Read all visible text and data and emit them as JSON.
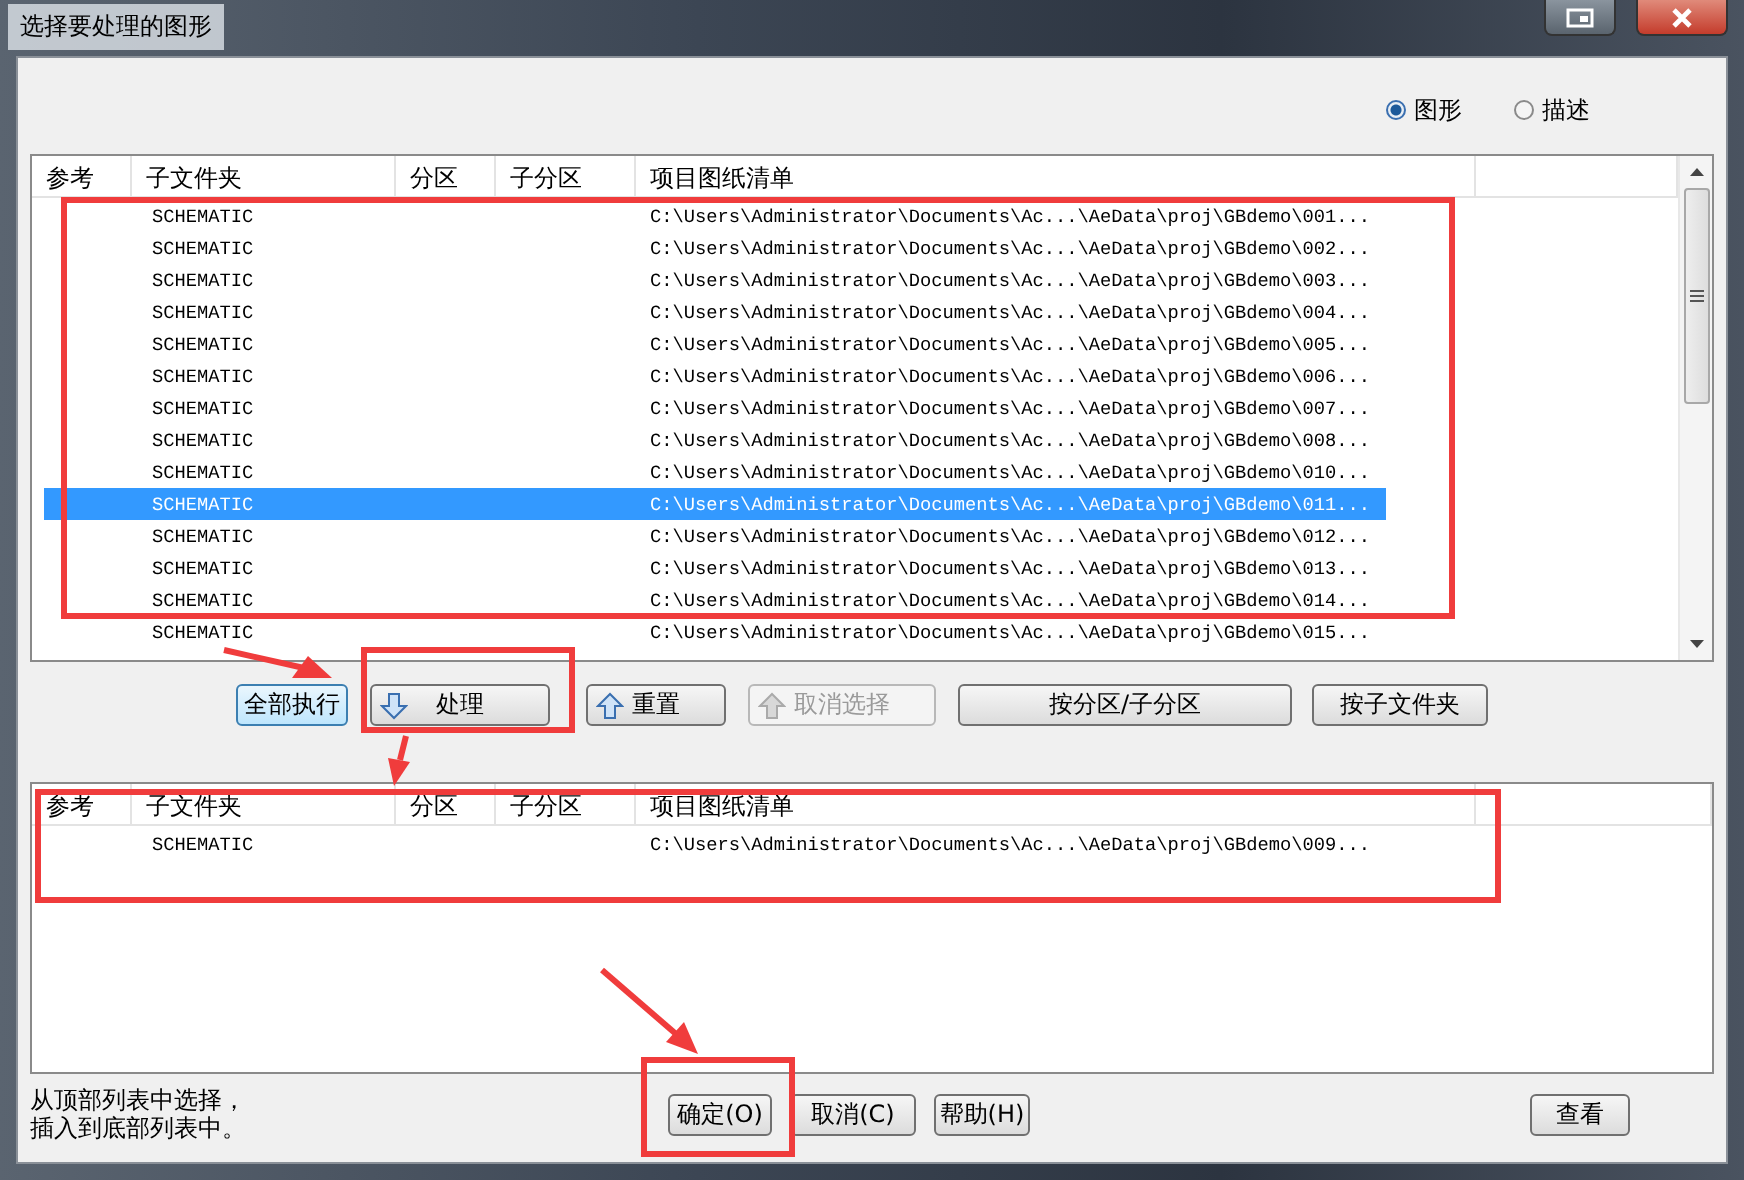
{
  "window": {
    "title": "选择要处理的图形"
  },
  "view_options": [
    {
      "label": "图形",
      "selected": true
    },
    {
      "label": "描述",
      "selected": false
    }
  ],
  "top_list": {
    "columns": [
      "参考",
      "子文件夹",
      "分区",
      "子分区",
      "项目图纸清单"
    ],
    "rows": [
      {
        "subfolder": "SCHEMATIC",
        "path": "C:\\Users\\Administrator\\Documents\\Ac...\\AeData\\proj\\GBdemo\\001...",
        "selected": false
      },
      {
        "subfolder": "SCHEMATIC",
        "path": "C:\\Users\\Administrator\\Documents\\Ac...\\AeData\\proj\\GBdemo\\002...",
        "selected": false
      },
      {
        "subfolder": "SCHEMATIC",
        "path": "C:\\Users\\Administrator\\Documents\\Ac...\\AeData\\proj\\GBdemo\\003...",
        "selected": false
      },
      {
        "subfolder": "SCHEMATIC",
        "path": "C:\\Users\\Administrator\\Documents\\Ac...\\AeData\\proj\\GBdemo\\004...",
        "selected": false
      },
      {
        "subfolder": "SCHEMATIC",
        "path": "C:\\Users\\Administrator\\Documents\\Ac...\\AeData\\proj\\GBdemo\\005...",
        "selected": false
      },
      {
        "subfolder": "SCHEMATIC",
        "path": "C:\\Users\\Administrator\\Documents\\Ac...\\AeData\\proj\\GBdemo\\006...",
        "selected": false
      },
      {
        "subfolder": "SCHEMATIC",
        "path": "C:\\Users\\Administrator\\Documents\\Ac...\\AeData\\proj\\GBdemo\\007...",
        "selected": false
      },
      {
        "subfolder": "SCHEMATIC",
        "path": "C:\\Users\\Administrator\\Documents\\Ac...\\AeData\\proj\\GBdemo\\008...",
        "selected": false
      },
      {
        "subfolder": "SCHEMATIC",
        "path": "C:\\Users\\Administrator\\Documents\\Ac...\\AeData\\proj\\GBdemo\\010...",
        "selected": false
      },
      {
        "subfolder": "SCHEMATIC",
        "path": "C:\\Users\\Administrator\\Documents\\Ac...\\AeData\\proj\\GBdemo\\011...",
        "selected": true
      },
      {
        "subfolder": "SCHEMATIC",
        "path": "C:\\Users\\Administrator\\Documents\\Ac...\\AeData\\proj\\GBdemo\\012...",
        "selected": false
      },
      {
        "subfolder": "SCHEMATIC",
        "path": "C:\\Users\\Administrator\\Documents\\Ac...\\AeData\\proj\\GBdemo\\013...",
        "selected": false
      },
      {
        "subfolder": "SCHEMATIC",
        "path": "C:\\Users\\Administrator\\Documents\\Ac...\\AeData\\proj\\GBdemo\\014...",
        "selected": false
      },
      {
        "subfolder": "SCHEMATIC",
        "path": "C:\\Users\\Administrator\\Documents\\Ac...\\AeData\\proj\\GBdemo\\015...",
        "selected": false
      }
    ]
  },
  "actions": [
    {
      "label": "全部执行",
      "disabled": false
    },
    {
      "label": "处理",
      "disabled": false
    },
    {
      "label": "重置",
      "disabled": false
    },
    {
      "label": "取消选择",
      "disabled": true
    },
    {
      "label": "按分区/子分区",
      "disabled": false
    },
    {
      "label": "按子文件夹",
      "disabled": false
    }
  ],
  "bottom_list": {
    "columns": [
      "参考",
      "子文件夹",
      "分区",
      "子分区",
      "项目图纸清单"
    ],
    "rows": [
      {
        "subfolder": "SCHEMATIC",
        "path": "C:\\Users\\Administrator\\Documents\\Ac...\\AeData\\proj\\GBdemo\\009..."
      }
    ]
  },
  "hint": [
    "从顶部列表中选择，",
    "插入到底部列表中。"
  ],
  "footer_buttons": [
    "确定(O)",
    "取消(C)",
    "帮助(H)"
  ],
  "view_button": "查看"
}
